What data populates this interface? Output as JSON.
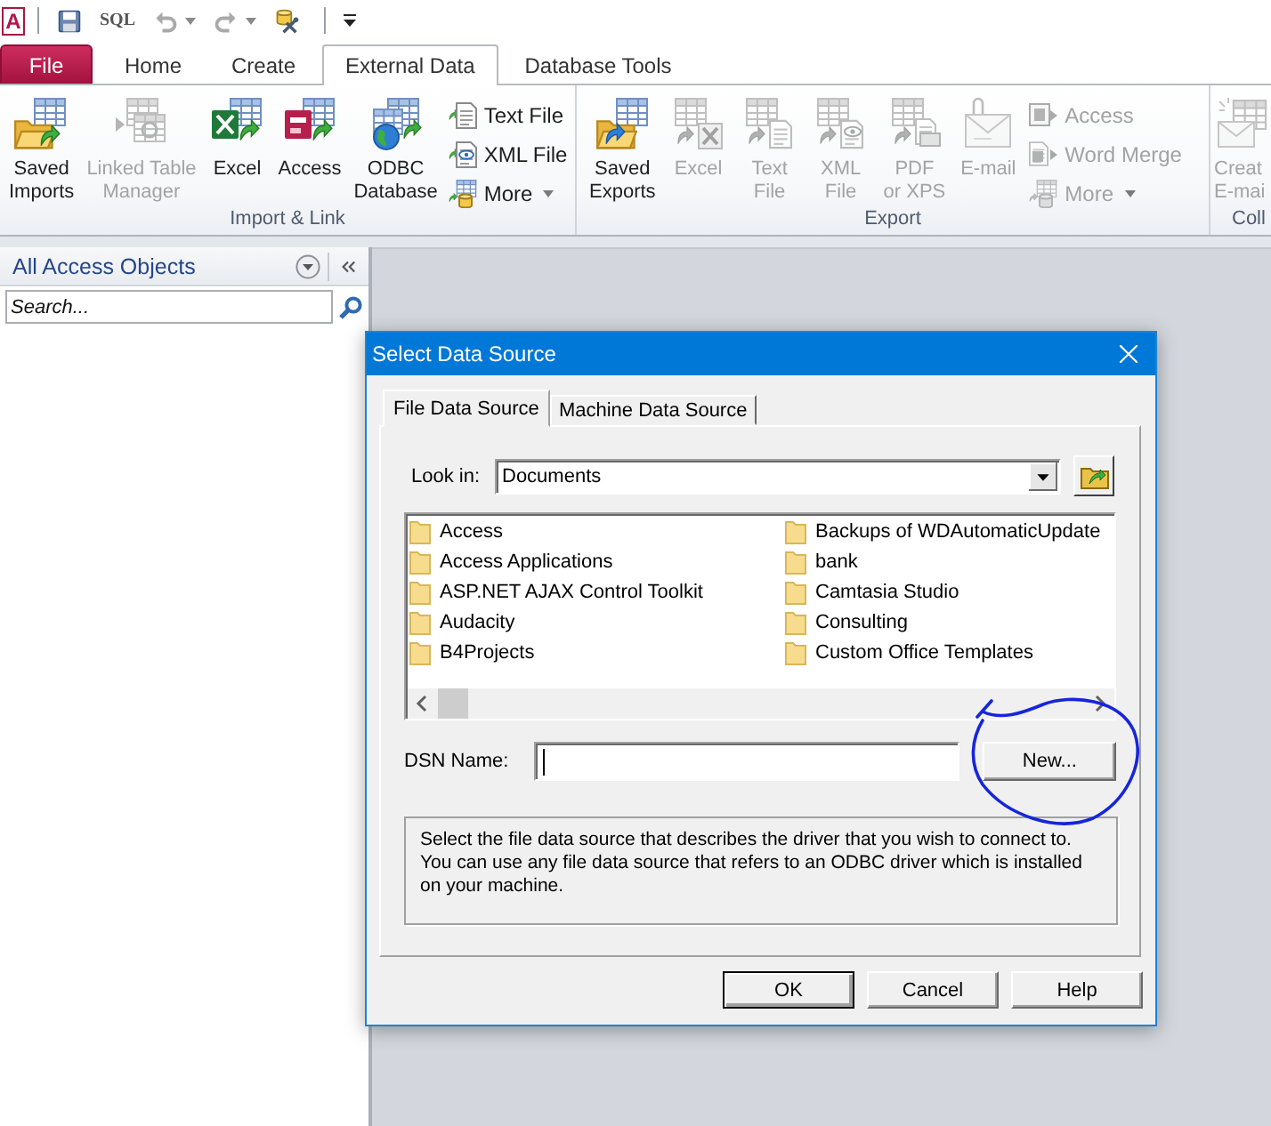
{
  "quick_access": {
    "logo": "A",
    "sql": "SQL",
    "undo": {
      "disabled": true
    },
    "redo": {
      "disabled": true
    }
  },
  "tabs": [
    {
      "label": "File",
      "kind": "file",
      "selected": false
    },
    {
      "label": "Home",
      "kind": "tab",
      "selected": false
    },
    {
      "label": "Create",
      "kind": "tab",
      "selected": false
    },
    {
      "label": "External Data",
      "kind": "tab",
      "selected": true
    },
    {
      "label": "Database Tools",
      "kind": "tab",
      "selected": false
    }
  ],
  "ribbon": {
    "groups": [
      {
        "label": "Import & Link",
        "large": [
          {
            "lines": [
              "Saved",
              "Imports"
            ],
            "disabled": false
          },
          {
            "lines": [
              "Linked Table",
              "Manager"
            ],
            "disabled": true
          },
          {
            "lines": [
              "Excel"
            ],
            "disabled": false
          },
          {
            "lines": [
              "Access"
            ],
            "disabled": false
          },
          {
            "lines": [
              "ODBC",
              "Database"
            ],
            "disabled": false
          }
        ],
        "small": [
          {
            "label": "Text File",
            "disabled": false,
            "dropdown": false
          },
          {
            "label": "XML File",
            "disabled": false,
            "dropdown": false
          },
          {
            "label": "More",
            "disabled": false,
            "dropdown": true
          }
        ]
      },
      {
        "label": "Export",
        "large": [
          {
            "lines": [
              "Saved",
              "Exports"
            ],
            "disabled": false
          },
          {
            "lines": [
              "Excel"
            ],
            "disabled": true
          },
          {
            "lines": [
              "Text",
              "File"
            ],
            "disabled": true
          },
          {
            "lines": [
              "XML",
              "File"
            ],
            "disabled": true
          },
          {
            "lines": [
              "PDF",
              "or XPS"
            ],
            "disabled": true
          },
          {
            "lines": [
              "E-mail"
            ],
            "disabled": true
          }
        ],
        "small": [
          {
            "label": "Access",
            "disabled": true,
            "dropdown": false
          },
          {
            "label": "Word Merge",
            "disabled": true,
            "dropdown": false
          },
          {
            "label": "More",
            "disabled": true,
            "dropdown": true
          }
        ]
      },
      {
        "label": "Coll",
        "large": [
          {
            "lines": [
              "Creat",
              "E-mai"
            ],
            "disabled": true
          }
        ]
      }
    ]
  },
  "nav_pane": {
    "title": "All Access Objects",
    "search": {
      "placeholder": "Search..."
    }
  },
  "dialog": {
    "title": "Select Data Source",
    "tabs": [
      {
        "label": "File Data Source",
        "selected": true
      },
      {
        "label": "Machine Data Source",
        "selected": false
      }
    ],
    "look_in": {
      "label": "Look in:",
      "value": "Documents"
    },
    "folders": [
      "Access",
      "Access Applications",
      "ASP.NET AJAX Control Toolkit",
      "Audacity",
      "B4Projects",
      "Backups of WDAutomaticUpdate",
      "bank",
      "Camtasia Studio",
      "Consulting",
      "Custom Office Templates"
    ],
    "dsn": {
      "label": "DSN Name:",
      "focused": true
    },
    "new_button": "New...",
    "description": "Select the file data source that describes the driver that you wish to connect to. You can use any file data source that refers to an ODBC driver which is installed on your machine.",
    "buttons": [
      {
        "label": "OK",
        "default": true
      },
      {
        "label": "Cancel",
        "default": false
      },
      {
        "label": "Help",
        "default": false
      }
    ]
  }
}
